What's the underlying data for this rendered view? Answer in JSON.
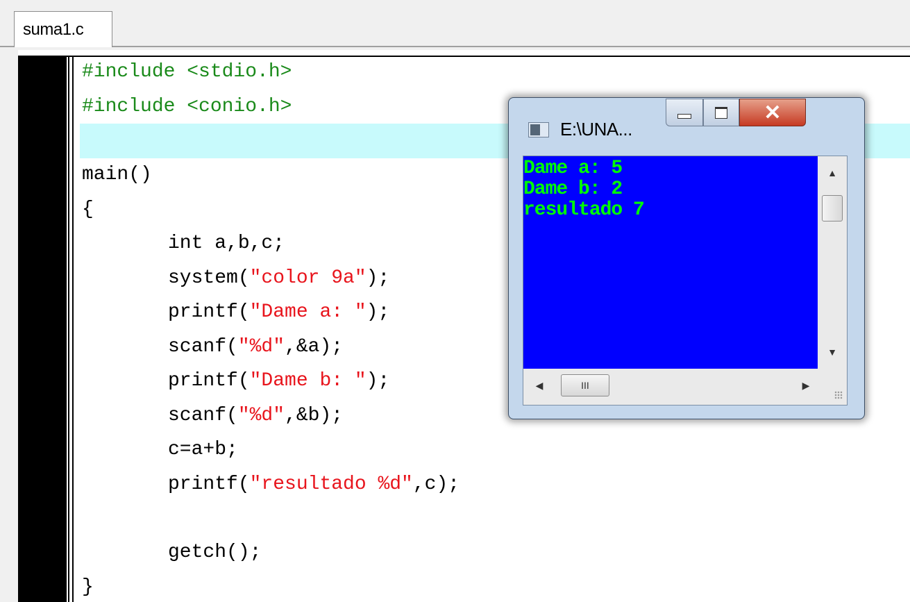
{
  "tab": {
    "label": "suma1.c"
  },
  "code": {
    "lines": [
      "#include <stdio.h>",
      "#include <conio.h>",
      "",
      "main()",
      "{",
      "int a,b,c;",
      "system(\"color 9a\");",
      "printf(\"Dame a: \");",
      "scanf(\"%d\",&a);",
      "printf(\"Dame b: \");",
      "scanf(\"%d\",&b);",
      "c=a+b;",
      "printf(\"resultado %d\",c);",
      "",
      "getch();",
      "}"
    ]
  },
  "console": {
    "title": "E:\\UNA...",
    "output": [
      "Dame a: 5",
      "Dame b: 2",
      "resultado 7"
    ],
    "background_color": "#0000ff",
    "text_color": "#00ff00",
    "minimize_icon": "minimize-icon",
    "maximize_icon": "maximize-icon",
    "close_icon": "close-icon",
    "hscroll_grip": "III"
  },
  "colors": {
    "preprocessor": "#1a8a1a",
    "string": "#e8141c",
    "current_line": "#c8fafc"
  }
}
